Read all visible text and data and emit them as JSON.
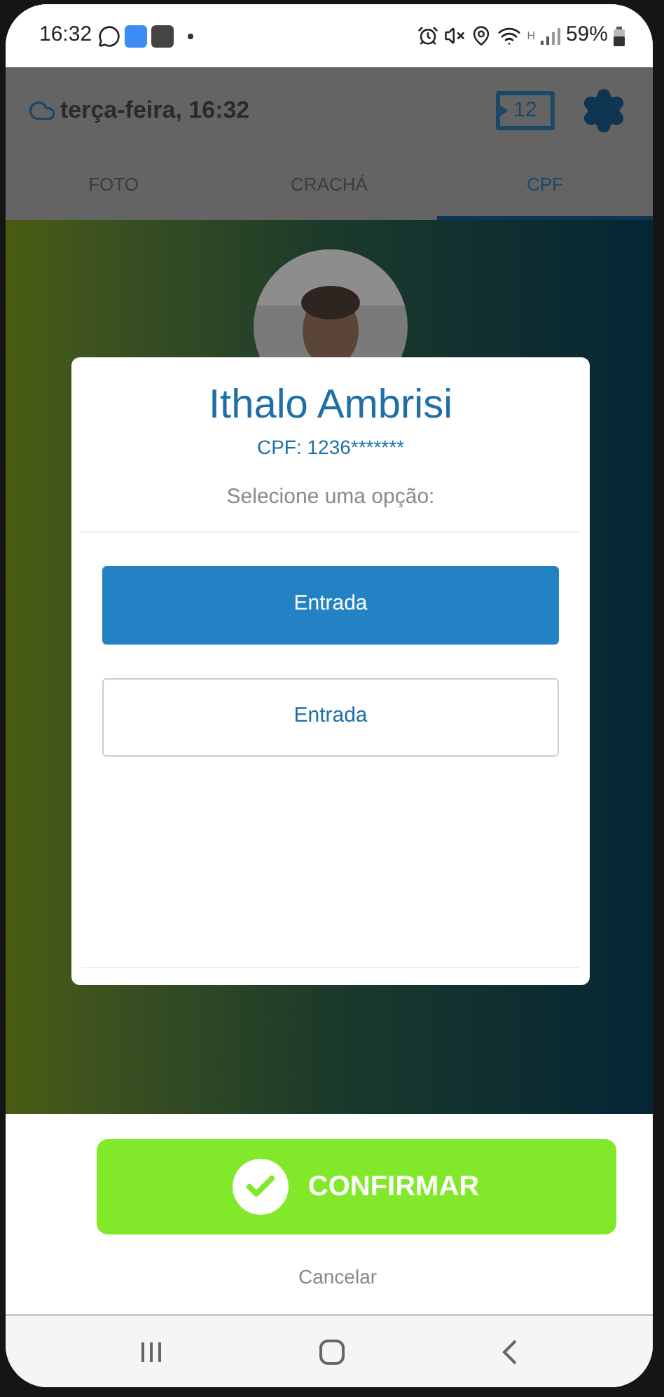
{
  "status_bar": {
    "time": "16:32",
    "network_label": "H",
    "battery": "59%"
  },
  "header": {
    "date": "terça-feira, 16:32",
    "badge": "12"
  },
  "tabs": [
    {
      "label": "FOTO",
      "selected": false
    },
    {
      "label": "CRACHÁ",
      "selected": false
    },
    {
      "label": "CPF",
      "selected": true
    }
  ],
  "dialog": {
    "name": "Ithalo Ambrisi",
    "cpf": "CPF: 1236*******",
    "prompt": "Selecione uma opção:",
    "options": [
      {
        "label": "Entrada",
        "selected": true
      },
      {
        "label": "Entrada",
        "selected": false
      }
    ]
  },
  "confirm_button": "CONFIRMAR",
  "cancel_link": "Cancelar"
}
